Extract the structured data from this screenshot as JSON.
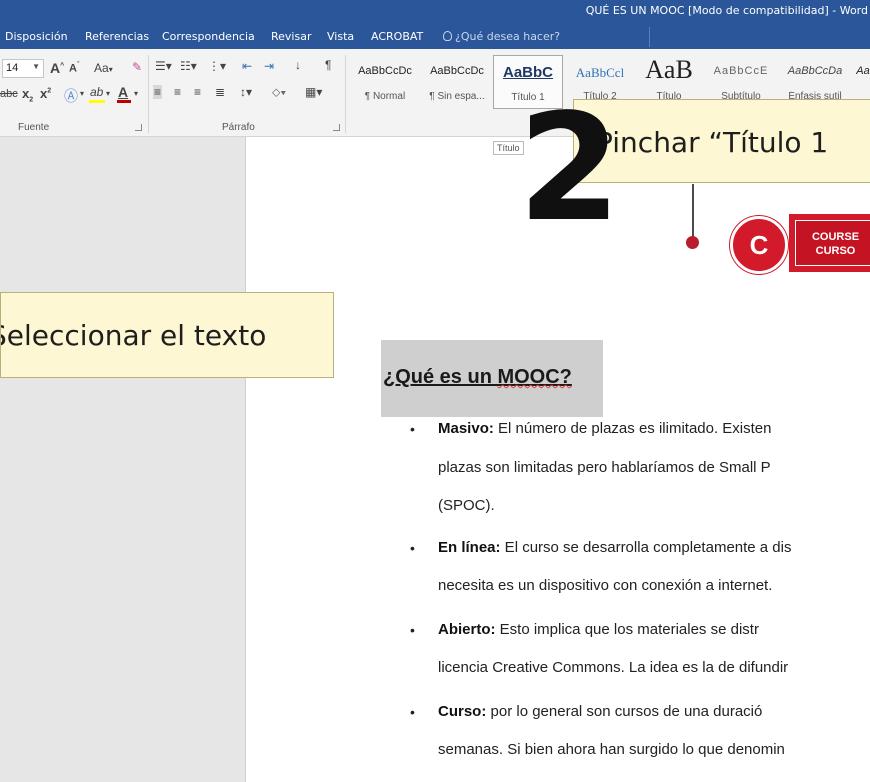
{
  "window": {
    "title": "QUÉ ES UN MOOC [Modo de compatibilidad] - Word"
  },
  "tabs": [
    {
      "label": "Disposición"
    },
    {
      "label": "Referencias"
    },
    {
      "label": "Correspondencia"
    },
    {
      "label": "Revisar"
    },
    {
      "label": "Vista"
    },
    {
      "label": "ACROBAT"
    },
    {
      "label": "¿Qué desea hacer?"
    }
  ],
  "font_group": {
    "font_size": "14",
    "grow_label": "A",
    "shrink_label": "A",
    "change_case_label": "Aa",
    "strike_label": "abc",
    "subscript_label": "x",
    "superscript_label": "x",
    "font_color_label": "A",
    "highlight_label": "ab",
    "group_label": "Fuente",
    "font_color": "#c00000",
    "highlight_color": "#ffff00"
  },
  "paragraph_group": {
    "group_label": "Párrafo"
  },
  "styles": [
    {
      "sample": "AaBbCcDc",
      "name": "¶ Normal"
    },
    {
      "sample": "AaBbCcDc",
      "name": "¶ Sin espa..."
    },
    {
      "sample": "AaBbC",
      "name": "Título 1"
    },
    {
      "sample": "AaBbCcl",
      "name": "Título 2"
    },
    {
      "sample": "AaB",
      "name": "Título"
    },
    {
      "sample": "AaBbCcE",
      "name": "Subtítulo"
    },
    {
      "sample": "AaBbCcDa",
      "name": "Énfasis sutil"
    },
    {
      "sample": "Aa",
      "name": ""
    }
  ],
  "tooltip": "Título",
  "callouts": {
    "step1": "Seleccionar el texto",
    "step2_number": "2",
    "step2": "Pinchar “Título 1"
  },
  "logo": {
    "letter": "C",
    "line1": "COURSE",
    "line2": "CURSO"
  },
  "document": {
    "heading_prefix": "¿Qué es un ",
    "heading_word": "MOOC?",
    "lines": [
      {
        "bold": "Masivo:",
        "text": " El número de plazas es ilimitado. Existen"
      },
      {
        "bold": "",
        "text": "plazas son limitadas pero hablaríamos de Small P"
      },
      {
        "bold": "",
        "text": "(SPOC)."
      },
      {
        "bold": "En línea:",
        "text": " El curso se desarrolla completamente a dis"
      },
      {
        "bold": "",
        "text": "necesita es un dispositivo con conexión a internet."
      },
      {
        "bold": "Abierto:",
        "text": " Esto implica que los materiales se distr"
      },
      {
        "bold": "",
        "text": "licencia Creative Commons. La idea es la de difundir"
      },
      {
        "bold": "Curso:",
        "text": " por lo general son cursos de una duració"
      },
      {
        "bold": "",
        "text": "semanas. Si bien ahora han surgido lo que denomin"
      }
    ]
  }
}
